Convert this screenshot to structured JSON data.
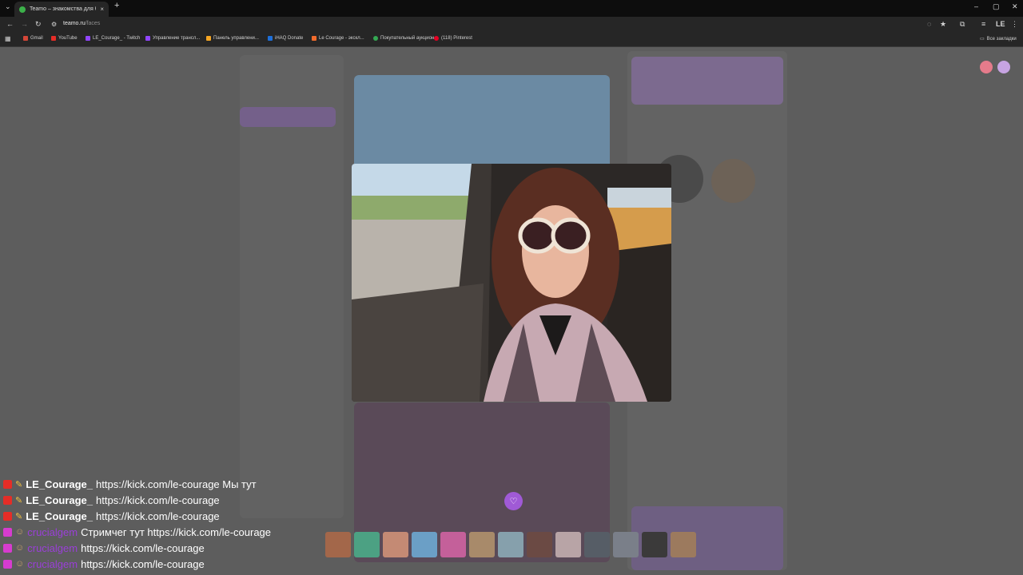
{
  "browser": {
    "tab_title": "Teamo – знакомства для брака",
    "new_tab_label": "+",
    "close_label": "×",
    "window_min": "–",
    "window_max": "▢",
    "window_close": "✕",
    "url_host": "teamo.ru",
    "url_path": "/faces",
    "profile_label": "LE",
    "bookmarks": [
      {
        "label": "Gmail",
        "color": "#d44638"
      },
      {
        "label": "YouTube",
        "color": "#e52d27"
      },
      {
        "label": "LE_Courage_ - Twitch",
        "color": "#9146ff"
      },
      {
        "label": "Управление трансл...",
        "color": "#9146ff"
      },
      {
        "label": "Панель управлени...",
        "color": "#f5a623"
      },
      {
        "label": "iHAQ Donate",
        "color": "#1e6fd9"
      },
      {
        "label": "Le Courage - экскл...",
        "color": "#f26b2c"
      },
      {
        "label": "Покупательный аукцион",
        "color": "#34a853"
      },
      {
        "label": "(118) Pinterest",
        "color": "#e60023"
      }
    ],
    "all_bookmarks": "Все закладки"
  },
  "modal": {
    "like_icon": "heart-icon"
  },
  "thumbnails": [
    {
      "color": "#a3674a"
    },
    {
      "color": "#4ca183"
    },
    {
      "color": "#c48a74"
    },
    {
      "color": "#6b9fc6"
    },
    {
      "color": "#c4609a"
    },
    {
      "color": "#a88a6a"
    },
    {
      "color": "#86a0ac"
    },
    {
      "color": "#6b4a44"
    },
    {
      "color": "#b8a4a6"
    },
    {
      "color": "#565d66"
    },
    {
      "color": "#7a7f89"
    },
    {
      "color": "#3b3a3a"
    },
    {
      "color": "#9c7a5e"
    }
  ],
  "chat": [
    {
      "user": "LE_Courage_",
      "message": "https://kick.com/le-courage Мы тут",
      "badge": "#e52d27",
      "purple": false
    },
    {
      "user": "LE_Courage_",
      "message": "https://kick.com/le-courage",
      "badge": "#e52d27",
      "purple": false
    },
    {
      "user": "LE_Courage_",
      "message": "https://kick.com/le-courage",
      "badge": "#e52d27",
      "purple": false
    },
    {
      "user": "crucialgem",
      "message": "Стримчег тут https://kick.com/le-courage",
      "badge": "#d63ccf",
      "purple": true
    },
    {
      "user": "crucialgem",
      "message": "https://kick.com/le-courage",
      "badge": "#d63ccf",
      "purple": true
    },
    {
      "user": "crucialgem",
      "message": "https://kick.com/le-courage",
      "badge": "#d63ccf",
      "purple": true
    }
  ]
}
